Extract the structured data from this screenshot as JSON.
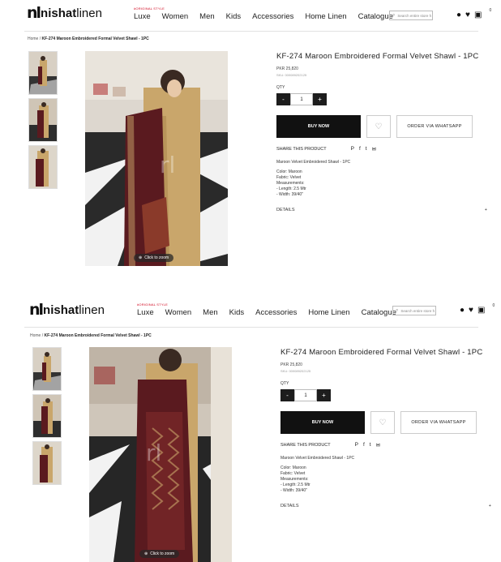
{
  "logo": {
    "mark": "nl",
    "bold": "nishat",
    "light": "linen"
  },
  "nav": {
    "luxe_badge": "#ORIGINAL STYLE",
    "items": [
      "Luxe",
      "Women",
      "Men",
      "Kids",
      "Accessories",
      "Home Linen",
      "Catalogue"
    ]
  },
  "search": {
    "placeholder": "Search entire store h"
  },
  "cart": {
    "count": "0"
  },
  "icons": {
    "search": "search-icon",
    "account": "user-icon",
    "wishlist": "heart-icon",
    "cart": "bag-icon",
    "zoom": "zoom-icon"
  },
  "breadcrumb": {
    "home": "Home",
    "sep": "/",
    "current": "KF-274 Maroon Embroidered Formal Velvet Shawl - 1PC"
  },
  "product": {
    "title": "KF-274 Maroon Embroidered Formal Velvet Shawl - 1PC",
    "price": "PKR 25,820",
    "sku": "SKU: 000089202125",
    "qty_label": "QTY",
    "qty_value": "1",
    "minus": "-",
    "plus": "+",
    "buy_now": "BUY NOW",
    "order_whatsapp": "ORDER VIA WHATSAPP",
    "share_label": "SHARE THIS PRODUCT",
    "share_icons": {
      "pinterest": "P",
      "facebook": "f",
      "twitter": "t",
      "mail": "✉"
    },
    "desc_name": "Maroon Velvet Embroidered Shawl - 1PC",
    "desc_color": "Color: Maroon",
    "desc_fabric": "Fabric: Velvet",
    "desc_measure": "Measurements:",
    "desc_length": "- Length: 2.5 Mtr",
    "desc_width": "- Width: 39/40\"",
    "details_label": "DETAILS",
    "details_toggle": "+",
    "zoom_label": "Click to zoom"
  },
  "colors": {
    "accent": "#111111",
    "badge": "#d0021b",
    "maroon": "#5a1a1f",
    "gold": "#c9a66b"
  }
}
